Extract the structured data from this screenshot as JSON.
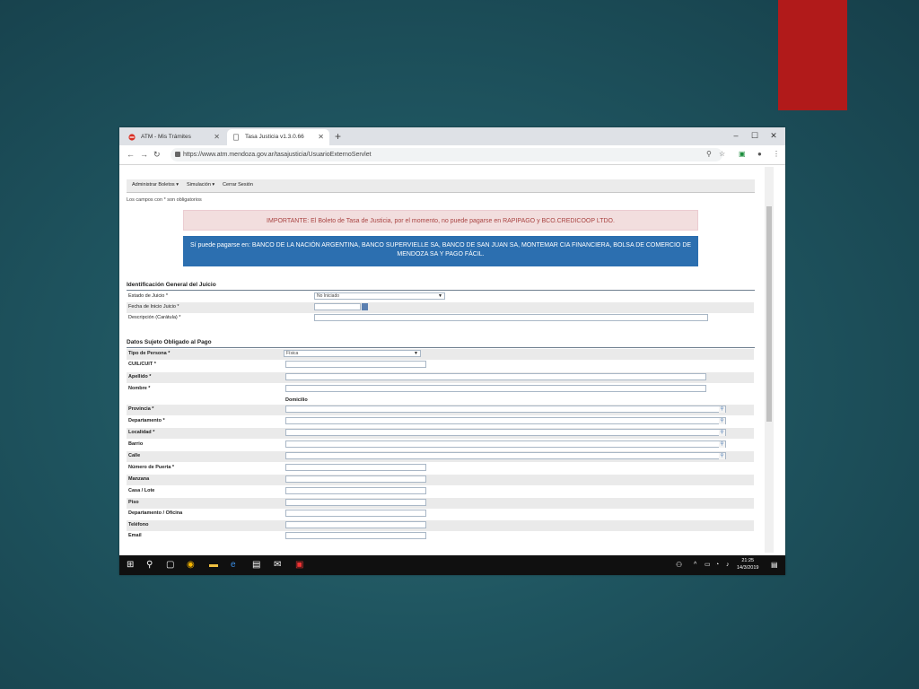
{
  "colors": {
    "slide_bg": "#1f5560",
    "accent_red": "#b11a1a",
    "alert_danger_bg": "#f2dede",
    "alert_info_bg": "#2c6fb0"
  },
  "browser": {
    "tabs": [
      {
        "title": "ATM - Mis Trámites",
        "icon": "no-entry-icon"
      },
      {
        "title": "Tasa Justicia v1.3.0.66",
        "icon": "page-icon"
      }
    ],
    "new_tab": "+",
    "window_controls": {
      "minimize": "–",
      "maximize": "☐",
      "close": "✕"
    },
    "url": "https://www.atm.mendoza.gov.ar/tasajusticia/UsuarioExternoServlet"
  },
  "menu": [
    "Administrar Boletos ▾",
    "Simulación ▾",
    "Cerrar Sesión"
  ],
  "required_note": "Los campos con * son obligatorios",
  "alerts": {
    "warning": "IMPORTANTE: El Boleto de Tasa de Justicia, por el momento, no puede pagarse en RAPIPAGO y BCO.CREDICOOP LTDO.",
    "info": "Sí puede pagarse en: BANCO DE LA NACIÓN ARGENTINA, BANCO SUPERVIELLE SA, BANCO DE SAN JUAN SA, MONTEMAR CIA FINANCIERA, BOLSA DE COMERCIO DE MENDOZA SA Y PAGO FÁCIL."
  },
  "section1": {
    "title": "Identificación General del Juicio",
    "fields": [
      {
        "label": "Estado de Juicio *",
        "value": "No Iniciado"
      },
      {
        "label": "Fecha de Inicio Juicio *",
        "value": ""
      },
      {
        "label": "Descripción (Carátula) *",
        "value": ""
      }
    ]
  },
  "section2": {
    "title": "Datos Sujeto Obligado al Pago",
    "domicilio_label": "Domicilio",
    "fields": [
      {
        "label": "Tipo de Persona *",
        "value": "Física"
      },
      {
        "label": "CUIL/CUIT *",
        "value": ""
      },
      {
        "label": "Apellido *",
        "value": ""
      },
      {
        "label": "Nombre *",
        "value": ""
      },
      {
        "label": "Provincia *",
        "value": ""
      },
      {
        "label": "Departamento *",
        "value": ""
      },
      {
        "label": "Localidad *",
        "value": ""
      },
      {
        "label": "Barrio",
        "value": ""
      },
      {
        "label": "Calle",
        "value": ""
      },
      {
        "label": "Número de Puerta *",
        "value": ""
      },
      {
        "label": "Manzana",
        "value": ""
      },
      {
        "label": "Casa / Lote",
        "value": ""
      },
      {
        "label": "Piso",
        "value": ""
      },
      {
        "label": "Departamento / Oficina",
        "value": ""
      },
      {
        "label": "Teléfono",
        "value": ""
      },
      {
        "label": "Email",
        "value": ""
      }
    ]
  },
  "taskbar": {
    "time": "21:25",
    "date": "14/3/2019",
    "icons": [
      "windows-start-icon",
      "search-icon",
      "task-view-icon",
      "chrome-icon",
      "file-explorer-icon",
      "edge-icon",
      "store-icon",
      "mail-icon",
      "pdf-reader-icon"
    ]
  }
}
